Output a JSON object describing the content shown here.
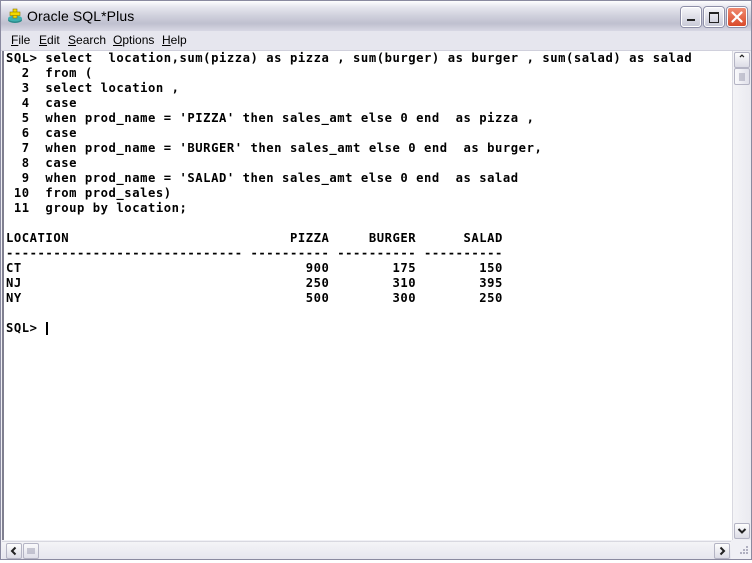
{
  "window": {
    "title": "Oracle SQL*Plus",
    "icon": "oracle-sqlplus-icon",
    "controls": [
      "minimize",
      "maximize",
      "close"
    ]
  },
  "menubar": {
    "items": [
      {
        "label": "File",
        "accel": "F"
      },
      {
        "label": "Edit",
        "accel": "E"
      },
      {
        "label": "Search",
        "accel": "S"
      },
      {
        "label": "Options",
        "accel": "O"
      },
      {
        "label": "Help",
        "accel": "H"
      }
    ]
  },
  "console": {
    "query_lines": [
      "SQL> select  location,sum(pizza) as pizza , sum(burger) as burger , sum(salad) as salad",
      "  2  from (",
      "  3  select location ,",
      "  4  case",
      "  5  when prod_name = 'PIZZA' then sales_amt else 0 end  as pizza ,",
      "  6  case",
      "  7  when prod_name = 'BURGER' then sales_amt else 0 end  as burger,",
      "  8  case",
      "  9  when prod_name = 'SALAD' then sales_amt else 0 end  as salad",
      " 10  from prod_sales)",
      " 11  group by location;"
    ],
    "result": {
      "columns": [
        "LOCATION",
        "PIZZA",
        "BURGER",
        "SALAD"
      ],
      "header_line": "LOCATION                            PIZZA     BURGER      SALAD",
      "separator_line": "------------------------------ ---------- ---------- ----------",
      "rows": [
        {
          "location": "CT",
          "pizza": "900",
          "burger": "175",
          "salad": "150",
          "line": "CT                                    900        175        150"
        },
        {
          "location": "NJ",
          "pizza": "250",
          "burger": "310",
          "salad": "395",
          "line": "NJ                                    250        310        395"
        },
        {
          "location": "NY",
          "pizza": "500",
          "burger": "300",
          "salad": "250",
          "line": "NY                                    500        300        250"
        }
      ]
    },
    "prompt": "SQL> "
  }
}
